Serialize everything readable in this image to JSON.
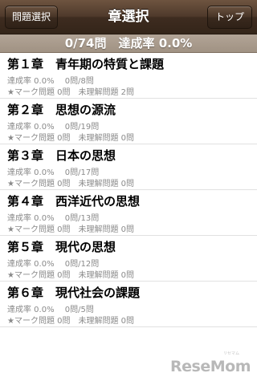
{
  "navbar": {
    "back_label": "問題選択",
    "title": "章選択",
    "top_label": "トップ"
  },
  "progress": {
    "text": "0/74問　達成率 0.0%"
  },
  "chapters": [
    {
      "title": "第１章　青年期の特質と課題",
      "stats": "達成率 0.0%　 0問/8問",
      "marks": "★マーク問題 0問　未理解問題 2問"
    },
    {
      "title": "第２章　思想の源流",
      "stats": "達成率 0.0%　 0問/19問",
      "marks": "★マーク問題 0問　未理解問題 0問"
    },
    {
      "title": "第３章　日本の思想",
      "stats": "達成率 0.0%　 0問/17問",
      "marks": "★マーク問題 0問　未理解問題 0問"
    },
    {
      "title": "第４章　西洋近代の思想",
      "stats": "達成率 0.0%　 0問/13問",
      "marks": "★マーク問題 0問　未理解問題 0問"
    },
    {
      "title": "第５章　現代の思想",
      "stats": "達成率 0.0%　 0問/12問",
      "marks": "★マーク問題 0問　未理解問題 0問"
    },
    {
      "title": "第６章　現代社会の課題",
      "stats": "達成率 0.0%　 0問/5問",
      "marks": "★マーク問題 0問　未理解問題 0問"
    }
  ],
  "watermark": {
    "text": "ReseMom",
    "sub": "リセマム"
  },
  "colors": {
    "navbar": "#4f3a2b",
    "progress_bar": "#a89a8c",
    "secondary_text": "#8a8a8a"
  }
}
